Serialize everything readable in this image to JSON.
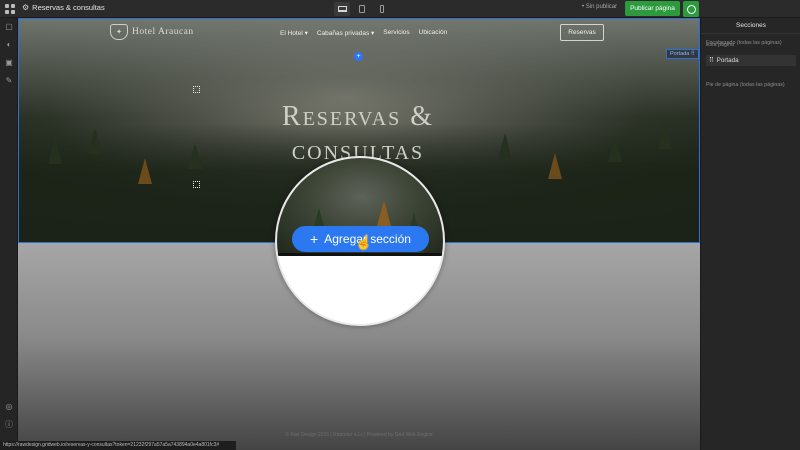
{
  "topbar": {
    "page_title": "Reservas & consultas",
    "unpublished_label": "• Sin publicar",
    "publish_label": "Publicar página"
  },
  "site": {
    "brand_name": "Hotel Araucan",
    "nav": [
      "El Hotel ▾",
      "Cabañas privadas ▾",
      "Servicios",
      "Ubicación"
    ],
    "cta_label": "Reservas",
    "hero_title": "Reservas & consultas",
    "section_tag": "Portada ⠿",
    "footer": "© Rae Design 2015 | Reporter s.l.c | Powered by Grid Web Engine"
  },
  "zoom": {
    "add_section_label": "Agregar sección"
  },
  "right_panel": {
    "title": "Secciones",
    "header_label": "Encabezado (todas las páginas)",
    "this_page_label": "Esta página",
    "section_item": "Portada",
    "footer_label": "Pie de página (todas las páginas)"
  },
  "status_url": "https://rawdesign.gridweb.io/reservas-y-consultas?token=21232f297a57a5a743894a0e4a801fc3#",
  "colors": {
    "accent": "#2b78f0",
    "publish": "#2d9a3e",
    "selection": "#2f6fd6"
  }
}
